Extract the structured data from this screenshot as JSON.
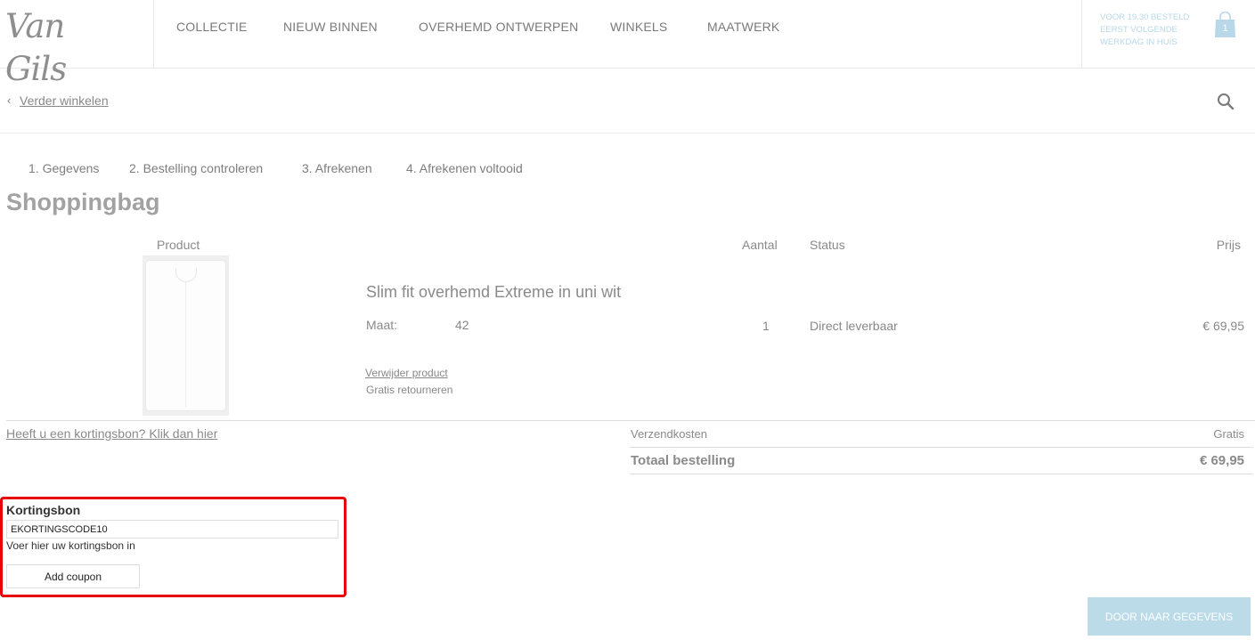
{
  "header": {
    "logo": "Van Gils",
    "nav": [
      "COLLECTIE",
      "NIEUW BINNEN",
      "OVERHEMD ONTWERPEN",
      "WINKELS",
      "MAATWERK"
    ],
    "promo_lines": [
      "VOOR 19.30 BESTELD",
      "EERST VOLGENDE",
      "WERKDAG IN HUIS"
    ],
    "cart_count": "1",
    "cart_icon": "shopping-bag-icon"
  },
  "subbar": {
    "back_label": "Verder winkelen",
    "back_icon": "chevron-left-icon",
    "search_icon": "search-icon"
  },
  "steps": [
    "1. Gegevens",
    "2. Bestelling controleren",
    "3. Afrekenen",
    "4. Afrekenen voltooid"
  ],
  "page_title": "Shoppingbag",
  "table": {
    "headers": {
      "product": "Product",
      "qty": "Aantal",
      "status": "Status",
      "price": "Prijs"
    },
    "items": [
      {
        "name": "Slim fit overhemd Extreme in uni wit",
        "size_label": "Maat:",
        "size": "42",
        "qty": "1",
        "status": "Direct leverbaar",
        "price": "€ 69,95",
        "remove_label": "Verwijder product",
        "return_note": "Gratis retourneren"
      }
    ]
  },
  "coupon_link": "Heeft u een kortingsbon? Klik dan hier",
  "totals": {
    "shipping_label": "Verzendkosten",
    "shipping_value": "Gratis",
    "total_label": "Totaal bestelling",
    "total_value": "€ 69,95"
  },
  "coupon": {
    "title": "Kortingsbon",
    "value": "EKORTINGSCODE10",
    "help": "Voer hier uw kortingsbon in",
    "button": "Add coupon",
    "highlight_color": "#e8000b"
  },
  "next_button": "DOOR NAAR GEGEVENS",
  "colors": {
    "accent": "#bcdbe9",
    "promo": "#b8d7e8"
  }
}
